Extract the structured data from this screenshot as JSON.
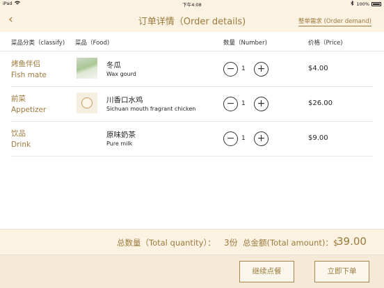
{
  "status_bar": {
    "device": "iPad",
    "time": "下午4:08",
    "battery": "100%"
  },
  "nav": {
    "back_glyph": "‹",
    "title": "订单详情（Order details)",
    "right_link": "整单需求 (Order demand)"
  },
  "table_header": {
    "classify": "菜品分类（classify)",
    "food": "菜品（Food)",
    "number": "数量（Number)",
    "price": "价格（Price)"
  },
  "items": [
    {
      "category_cn": "烤鱼伴侣",
      "category_en": "Fish mate",
      "food_cn": "冬瓜",
      "food_en": "Wax gourd",
      "quantity": "1",
      "price": "$4.00",
      "image": "wax-gourd-photo"
    },
    {
      "category_cn": "前菜",
      "category_en": "Appetizer",
      "food_cn": "川香口水鸡",
      "food_en": "Sichuan mouth fragrant chicken",
      "quantity": "1",
      "price": "$26.00",
      "image": "chicken-placeholder-logo"
    },
    {
      "category_cn": "饮品",
      "category_en": "Drink",
      "food_cn": "原味奶茶",
      "food_en": "Pure milk",
      "quantity": "1",
      "price": "$9.00",
      "image": ""
    }
  ],
  "stepper": {
    "minus_glyph": "−",
    "plus_glyph": "+"
  },
  "totals": {
    "quantity_label": "总数量（Total quantity）：",
    "quantity_value": "3份",
    "amount_label": "总金额(Total amount)：$",
    "amount_value": "39.00"
  },
  "buttons": {
    "continue_label": "继续点餐",
    "order_label": "立即下单"
  },
  "colors": {
    "accent": "#9b7a3f",
    "header_bg": "#fbf2e2",
    "footer_bg": "#f4ead7"
  }
}
